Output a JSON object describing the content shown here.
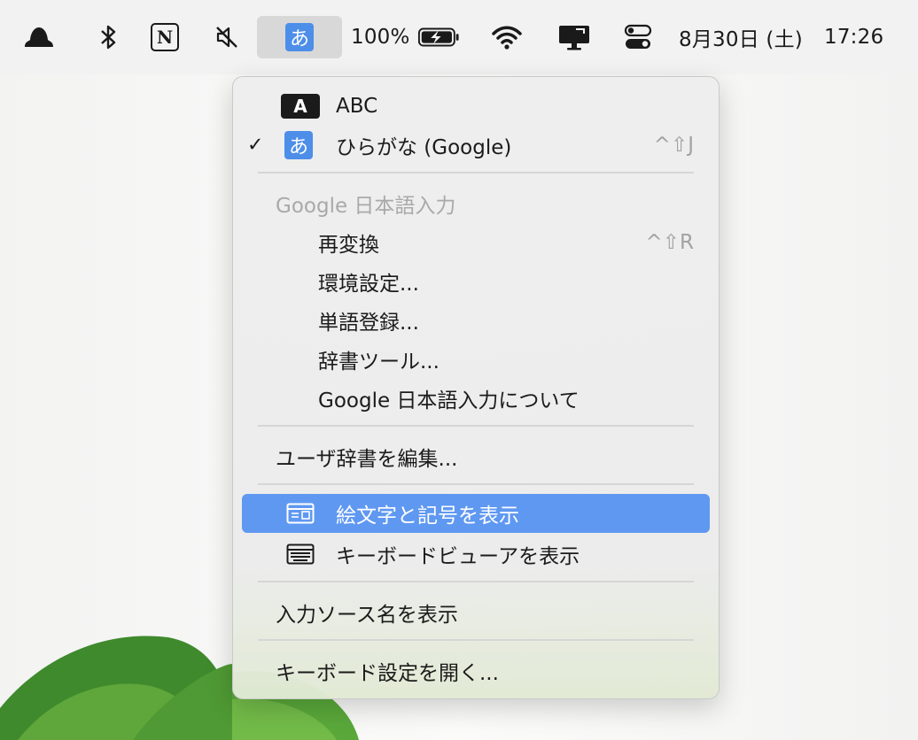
{
  "menubar": {
    "items": [
      {
        "name": "hat-icon"
      },
      {
        "name": "bluetooth-icon"
      },
      {
        "name": "notion-icon",
        "label": "N"
      },
      {
        "name": "muted-speaker-icon"
      },
      {
        "name": "input-source-icon",
        "label": "あ"
      },
      {
        "name": "battery",
        "label": "100%"
      },
      {
        "name": "wifi-icon"
      },
      {
        "name": "display-icon"
      },
      {
        "name": "control-center-icon"
      }
    ],
    "date": "8月30日 (土)",
    "time": "17:26"
  },
  "menu": {
    "abc_label": "ABC",
    "abc_badge": "A",
    "hiragana_label": "ひらがな (Google)",
    "hiragana_badge": "あ",
    "hiragana_shortcut": "^⇧J",
    "checkmark": "✓",
    "section_header": "Google 日本語入力",
    "reconvert_label": "再変換",
    "reconvert_shortcut": "^⇧R",
    "preferences_label": "環境設定...",
    "word_register_label": "単語登録...",
    "dictionary_tool_label": "辞書ツール...",
    "about_label": "Google 日本語入力について",
    "edit_user_dict_label": "ユーザ辞書を編集...",
    "emoji_label": "絵文字と記号を表示",
    "keyboard_viewer_label": "キーボードビューアを表示",
    "show_input_name_label": "入力ソース名を表示",
    "open_keyboard_settings_label": "キーボード設定を開く..."
  },
  "colors": {
    "highlight": "#5f98f1",
    "hiragana_badge": "#4d8ee9"
  }
}
